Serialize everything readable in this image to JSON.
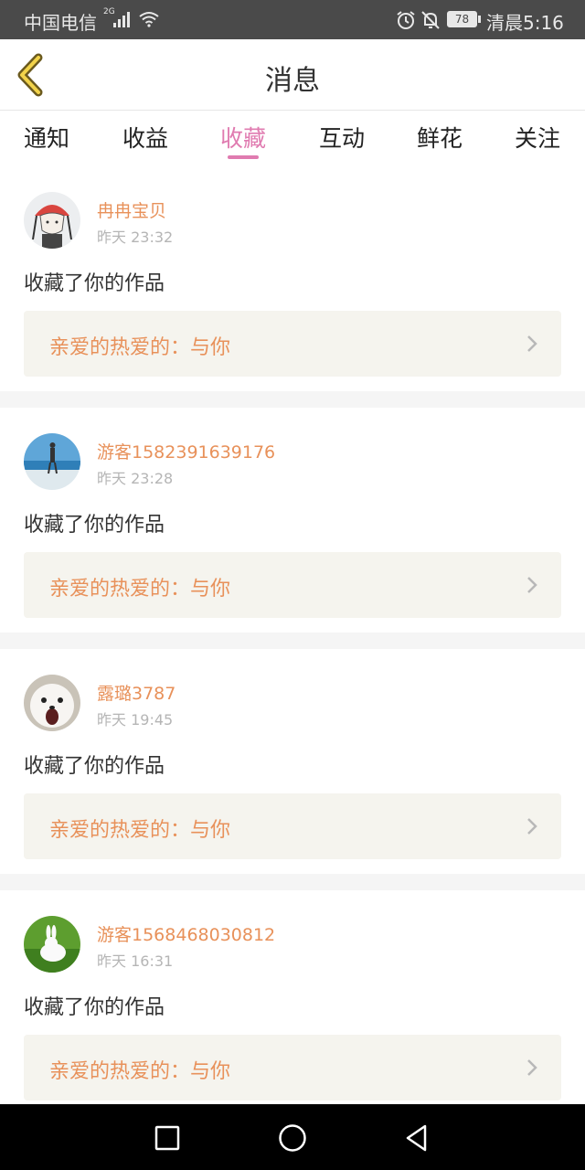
{
  "status_bar": {
    "carrier": "中国电信",
    "network": "2G",
    "battery": "78",
    "time": "清晨5:16"
  },
  "header": {
    "title": "消息"
  },
  "tabs": [
    {
      "label": "通知"
    },
    {
      "label": "收益"
    },
    {
      "label": "收藏",
      "active": true
    },
    {
      "label": "互动"
    },
    {
      "label": "鲜花"
    },
    {
      "label": "关注"
    }
  ],
  "feed": [
    {
      "name": "冉冉宝贝",
      "time": "昨天 23:32",
      "action": "收藏了你的作品",
      "work": "亲爱的热爱的：与你"
    },
    {
      "name": "游客1582391639176",
      "time": "昨天 23:28",
      "action": "收藏了你的作品",
      "work": "亲爱的热爱的：与你"
    },
    {
      "name": "露璐3787",
      "time": "昨天 19:45",
      "action": "收藏了你的作品",
      "work": "亲爱的热爱的：与你"
    },
    {
      "name": "游客1568468030812",
      "time": "昨天 16:31",
      "action": "收藏了你的作品",
      "work": "亲爱的热爱的：与你"
    }
  ],
  "colors": {
    "accent": "#e07bb0",
    "username": "#e8915a",
    "card_bg": "#f5f4ee"
  }
}
